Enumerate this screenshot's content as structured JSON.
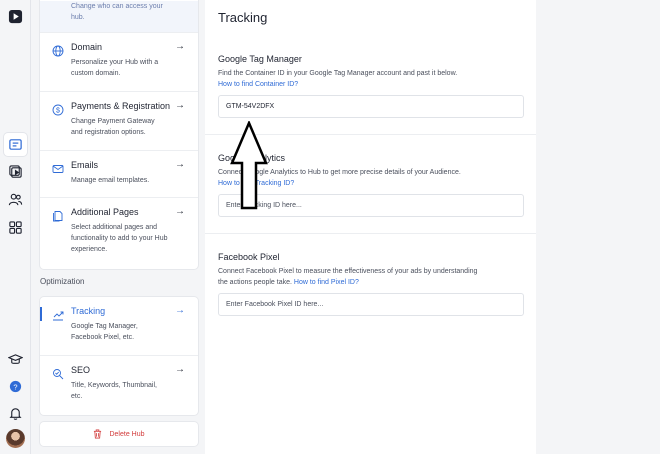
{
  "rail": {
    "icons": [
      "play-logo-icon",
      "hub-settings-icon",
      "video-library-icon",
      "audience-icon",
      "apps-icon",
      "academy-icon",
      "help-icon",
      "notifications-icon"
    ]
  },
  "settings": {
    "top_item_desc": "Change who can access your hub.",
    "items": [
      {
        "title": "Domain",
        "desc": "Personalize your Hub with a custom domain.",
        "arrow": "→"
      },
      {
        "title": "Payments & Registration",
        "desc": "Change Payment Gateway and registration options.",
        "arrow": "→"
      },
      {
        "title": "Emails",
        "desc": "Manage email templates.",
        "arrow": "→"
      },
      {
        "title": "Additional Pages",
        "desc": "Select additional pages and functionality to add to your Hub experience.",
        "arrow": "→"
      }
    ],
    "section_label": "Optimization",
    "optimization_items": [
      {
        "title": "Tracking",
        "desc": "Google Tag Manager, Facebook Pixel, etc.",
        "arrow": "→"
      },
      {
        "title": "SEO",
        "desc": "Title, Keywords, Thumbnail, etc.",
        "arrow": "→"
      }
    ],
    "delete_label": "Delete Hub"
  },
  "main": {
    "title": "Tracking",
    "gtm": {
      "heading": "Google Tag Manager",
      "help": "Find the Container ID in your Google Tag Manager account and past it below.",
      "link": "How to find Container ID?",
      "value": "GTM-54V2DFX"
    },
    "ga": {
      "heading": "Google Analytics",
      "help": "Connect Google Analytics to Hub to get more precise details of your Audience.",
      "link": "How to find Tracking ID?",
      "placeholder": "Enter Tracking ID here..."
    },
    "fb": {
      "heading": "Facebook Pixel",
      "help": "Connect Facebook Pixel to measure the effectiveness of your ads by understanding the actions people take.",
      "link": "How to find Pixel ID?",
      "placeholder": "Enter Facebook Pixel ID here..."
    }
  },
  "colors": {
    "accent": "#2f6bd6",
    "danger": "#d23b3b"
  }
}
